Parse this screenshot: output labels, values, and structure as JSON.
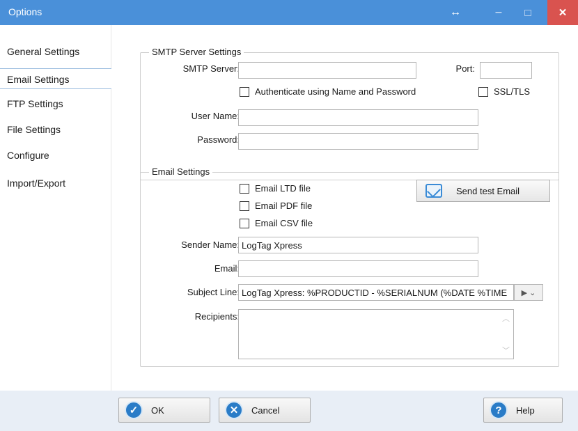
{
  "window": {
    "title": "Options"
  },
  "titlebar_icons": {
    "resize": "resize-arrows-icon",
    "minimize": "minimize-icon",
    "maximize": "maximize-icon",
    "close": "close-icon"
  },
  "titlebar_glyphs": {
    "resize": "↔",
    "minimize": "–",
    "close": "✕"
  },
  "sidebar": {
    "items": [
      {
        "label": "General Settings"
      },
      {
        "label": "Email Settings"
      },
      {
        "label": "FTP Settings"
      },
      {
        "label": "File Settings"
      },
      {
        "label": "Configure"
      },
      {
        "label": "Import/Export"
      }
    ],
    "selected": "Email Settings"
  },
  "smtp": {
    "legend": "SMTP Server Settings",
    "server_label": "SMTP Server:",
    "server_value": "",
    "port_label": "Port:",
    "port_value": "",
    "auth_label": "Authenticate using Name and Password",
    "auth_checked": false,
    "ssl_label": "SSL/TLS",
    "ssl_checked": false,
    "user_label": "User Name:",
    "user_value": "",
    "password_label": "Password:",
    "password_value": ""
  },
  "email": {
    "legend": "Email Settings",
    "ltd_label": "Email LTD file",
    "ltd_checked": false,
    "pdf_label": "Email PDF file",
    "pdf_checked": false,
    "csv_label": "Email CSV file",
    "csv_checked": false,
    "send_test_label": "Send test Email",
    "sender_label": "Sender Name:",
    "sender_value": "LogTag Xpress",
    "email_label": "Email:",
    "email_value": "",
    "subject_label": "Subject Line:",
    "subject_value": "LogTag Xpress: %PRODUCTID - %SERIALNUM (%DATE %TIME",
    "subject_button_glyph": "▶ ⌄",
    "recipients_label": "Recipients:",
    "recipients_value": "",
    "scroll_glyphs": {
      "up": "︿",
      "down": "﹀"
    }
  },
  "footer": {
    "ok_label": "OK",
    "cancel_label": "Cancel",
    "help_label": "Help",
    "icon_glyphs": {
      "ok": "✓",
      "cancel": "✕",
      "help": "?"
    }
  },
  "colors": {
    "titlebar": "#4a90d9",
    "close": "#d9534f",
    "footer": "#e8eef6",
    "accent": "#2a7cc7"
  }
}
